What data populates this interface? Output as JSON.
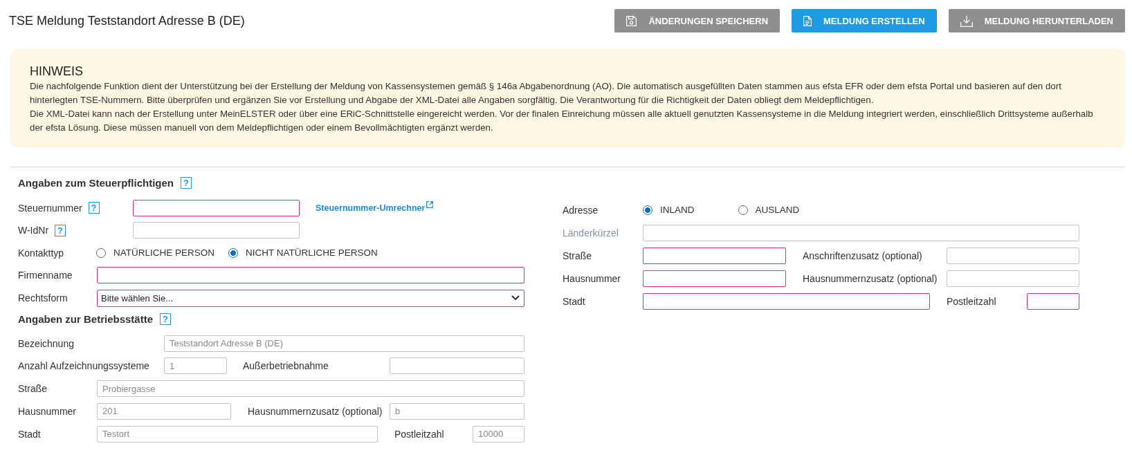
{
  "header": {
    "title": "TSE Meldung Teststandort Adresse B (DE)",
    "buttons": [
      {
        "label": "ÄNDERUNGEN SPEICHERN",
        "disabled": true
      },
      {
        "label": "MELDUNG ERSTELLEN",
        "disabled": false
      },
      {
        "label": "MELDUNG HERUNTERLADEN",
        "disabled": true
      }
    ]
  },
  "notice": {
    "title": "HINWEIS",
    "paragraphs": [
      "Die nachfolgende Funktion dient der Unterstützung bei der Erstellung der Meldung von Kassensystemen gemäß § 146a Abgabenordnung (AO). Die automatisch ausgefüllten Daten stammen aus efsta EFR oder dem efsta Portal und basieren auf den dort hinterlegten TSE-Nummern. Bitte überprüfen und ergänzen Sie vor Erstellung und Abgabe der XML-Datei alle Angaben sorgfältig. Die Verantwortung für die Richtigkeit der Daten obliegt dem Meldepflichtigen.",
      "Die XML-Datei kann nach der Erstellung unter MeinELSTER oder über eine ERiC-Schnittstelle eingereicht werden. Vor der finalen Einreichung müssen alle aktuell genutzten Kassensysteme in die Meldung integriert werden, einschließlich Drittsysteme außerhalb der efsta Lösung. Diese müssen manuell von dem Meldepflichtigen oder einem Bevollmächtigten ergänzt werden."
    ]
  },
  "taxpayer": {
    "heading": "Angaben zum Steuerpflichtigen",
    "help": "?",
    "rows": [
      [
        {
          "kind": "input",
          "label": "Steuernummer",
          "help": "?",
          "invalid": true,
          "link": "Steuernummer-Umrechner"
        }
      ],
      [
        {
          "kind": "input",
          "label": "W-IdNr",
          "help": "?",
          "invalid": false
        }
      ],
      [
        {
          "kind": "radio",
          "label": "Kontakttyp",
          "options": [
            {
              "label": "NATÜRLICHE PERSON",
              "selected": false
            },
            {
              "label": "NICHT NATÜRLICHE PERSON",
              "selected": true
            }
          ]
        }
      ],
      [
        {
          "kind": "input",
          "label": "Firmenname",
          "invalid": true
        }
      ],
      [
        {
          "kind": "select",
          "label": "Rechtsform",
          "value": "Bitte wählen Sie...",
          "invalid": true
        }
      ]
    ]
  },
  "establishment": {
    "heading": "Angaben zur Betriebsstätte",
    "help": "?",
    "rows": [
      [
        {
          "kind": "input",
          "label": "Bezeichnung",
          "value": "Teststandort Adresse B (DE)",
          "readonly": true,
          "invalid": false
        }
      ],
      [
        {
          "kind": "input",
          "label": "Anzahl Aufzeichnungssysteme",
          "value": "1",
          "readonly": true,
          "invalid": false
        },
        {
          "kind": "input",
          "label": "Außerbetriebnahme",
          "invalid": false
        }
      ],
      [
        {
          "kind": "input",
          "label": "Straße",
          "value": "Probiergasse",
          "readonly": true,
          "invalid": false
        }
      ],
      [
        {
          "kind": "input",
          "label": "Hausnummer",
          "value": "201",
          "readonly": true,
          "invalid": false
        },
        {
          "kind": "input",
          "label": "Hausnummernzusatz (optional)",
          "value": "b",
          "readonly": true,
          "invalid": false
        }
      ],
      [
        {
          "kind": "input",
          "label": "Stadt",
          "value": "Testort",
          "readonly": true,
          "invalid": false
        },
        {
          "kind": "input",
          "label": "Postleitzahl",
          "value": "10000",
          "readonly": true,
          "invalid": false
        }
      ]
    ]
  },
  "address": {
    "rows": [
      [
        {
          "kind": "radio",
          "label": "Adresse",
          "options": [
            {
              "label": "INLAND",
              "selected": true
            },
            {
              "label": "AUSLAND",
              "selected": false
            }
          ]
        }
      ],
      [
        {
          "kind": "input",
          "label": "Länderkürzel",
          "disabled": true,
          "invalid": false
        }
      ],
      [
        {
          "kind": "input",
          "label": "Straße",
          "disabled": false,
          "invalid": true
        },
        {
          "kind": "input",
          "label": "Anschriftenzusatz (optional)",
          "disabled": false,
          "invalid": false
        }
      ],
      [
        {
          "kind": "input",
          "label": "Hausnummer",
          "disabled": false,
          "invalid": true
        },
        {
          "kind": "input",
          "label": "Hausnummernzusatz (optional)",
          "disabled": false,
          "invalid": false
        }
      ],
      [
        {
          "kind": "input",
          "label": "Stadt",
          "disabled": false,
          "invalid": true
        },
        {
          "kind": "input",
          "label": "Postleitzahl",
          "disabled": false,
          "invalid": true
        }
      ]
    ]
  }
}
